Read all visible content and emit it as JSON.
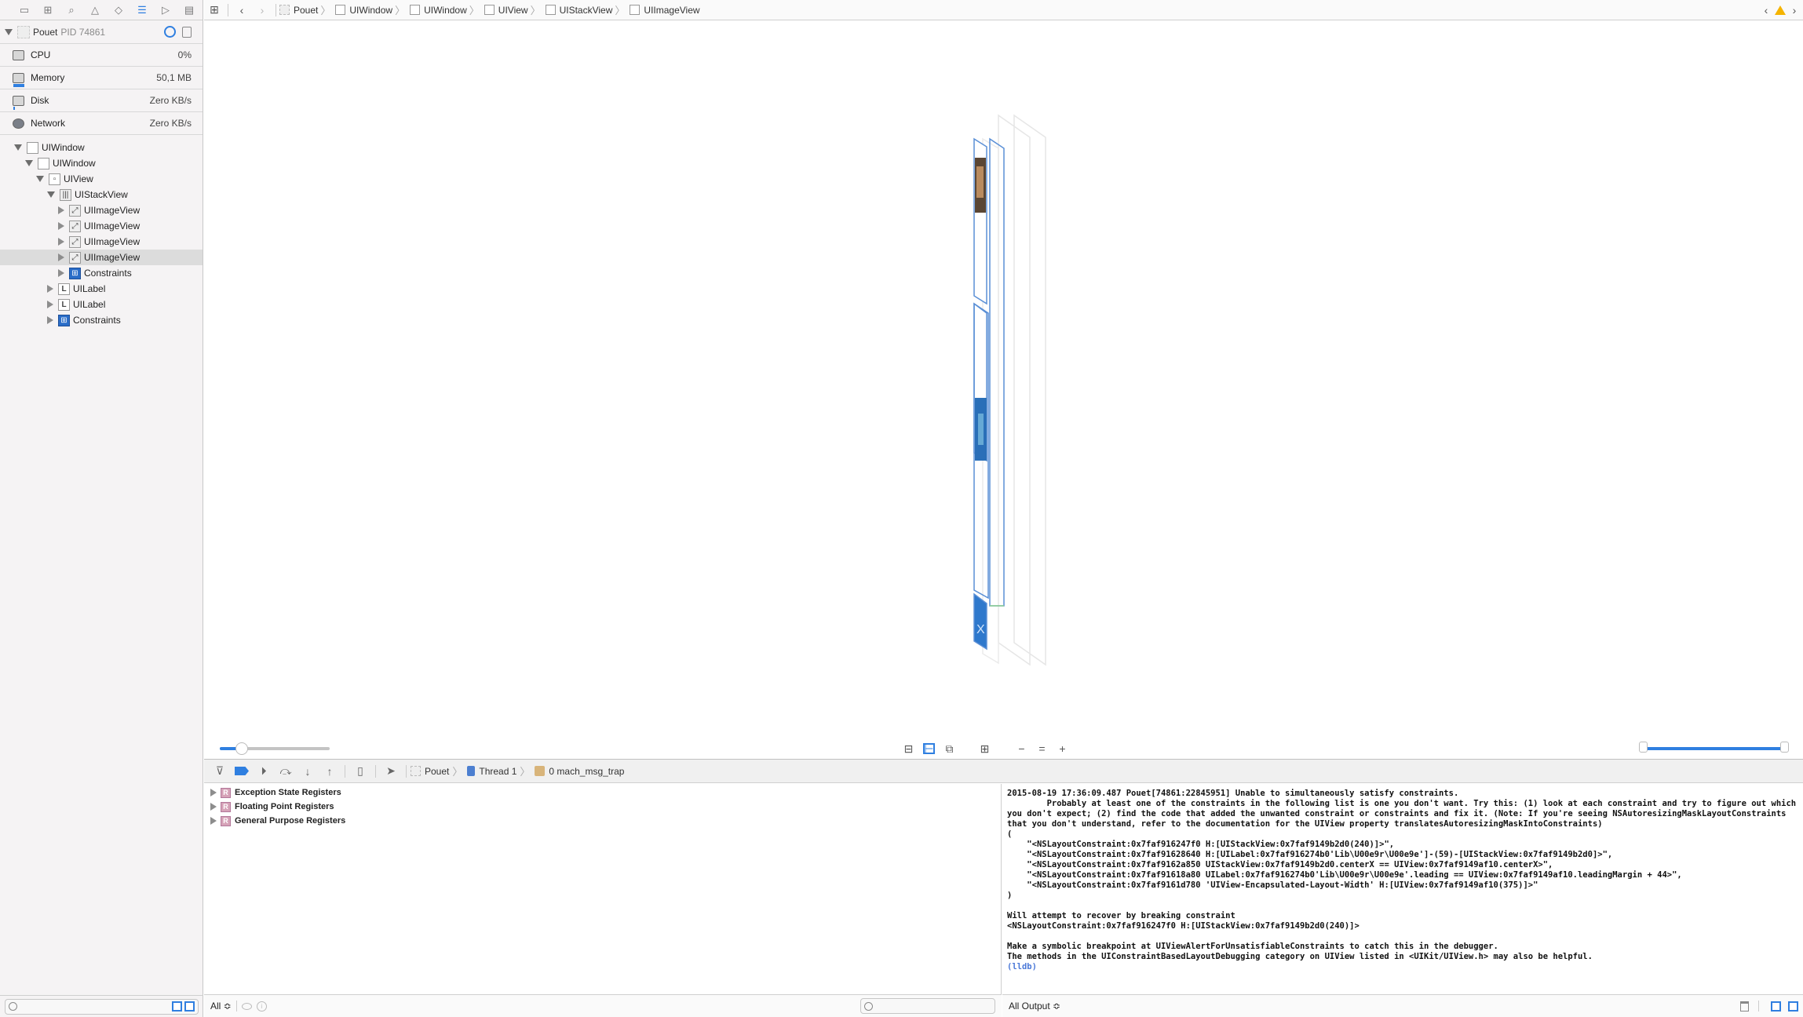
{
  "navigator": {
    "toolbar_icons": [
      "folder-icon",
      "hierarchy-icon",
      "search-icon",
      "warning-icon",
      "breakpoint-diamond-icon",
      "debug-navigator-icon",
      "tag-icon",
      "report-icon"
    ],
    "process": {
      "name": "Pouet",
      "pid": "PID 74861"
    },
    "metrics": [
      {
        "label": "CPU",
        "value": "0%",
        "icon": "cpu-icon"
      },
      {
        "label": "Memory",
        "value": "50,1 MB",
        "icon": "memory-icon",
        "gauge_fraction": 0.45
      },
      {
        "label": "Disk",
        "value": "Zero KB/s",
        "icon": "disk-icon",
        "gauge_fraction": 0.05
      },
      {
        "label": "Network",
        "value": "Zero KB/s",
        "icon": "network-icon"
      }
    ],
    "tree": [
      {
        "label": "UIWindow",
        "depth": 0,
        "expanded": true,
        "kind": "window"
      },
      {
        "label": "UIWindow",
        "depth": 1,
        "expanded": true,
        "kind": "window"
      },
      {
        "label": "UIView",
        "depth": 2,
        "expanded": true,
        "kind": "view"
      },
      {
        "label": "UIStackView",
        "depth": 3,
        "expanded": true,
        "kind": "stack"
      },
      {
        "label": "UIImageView",
        "depth": 4,
        "expanded": false,
        "kind": "image"
      },
      {
        "label": "UIImageView",
        "depth": 4,
        "expanded": false,
        "kind": "image"
      },
      {
        "label": "UIImageView",
        "depth": 4,
        "expanded": false,
        "kind": "image"
      },
      {
        "label": "UIImageView",
        "depth": 4,
        "expanded": false,
        "kind": "image",
        "selected": true
      },
      {
        "label": "Constraints",
        "depth": 4,
        "expanded": false,
        "kind": "constraints"
      },
      {
        "label": "UILabel",
        "depth": 3,
        "expanded": false,
        "kind": "label"
      },
      {
        "label": "UILabel",
        "depth": 3,
        "expanded": false,
        "kind": "label"
      },
      {
        "label": "Constraints",
        "depth": 3,
        "expanded": false,
        "kind": "constraints"
      }
    ]
  },
  "jumpbar": {
    "crumbs": [
      "Pouet",
      "UIWindow",
      "UIWindow",
      "UIView",
      "UIStackView",
      "UIImageView"
    ]
  },
  "canvas": {
    "spacing_slider_fraction": 0.2,
    "range_slider": [
      0.0,
      1.0
    ]
  },
  "debugbar": {
    "crumbs": [
      "Pouet",
      "Thread 1",
      "0 mach_msg_trap"
    ]
  },
  "variables": {
    "rows": [
      "Exception State Registers",
      "Floating Point Registers",
      "General Purpose Registers"
    ],
    "scope": "All ≎"
  },
  "console": {
    "text": "2015-08-19 17:36:09.487 Pouet[74861:22845951] Unable to simultaneously satisfy constraints.\n\tProbably at least one of the constraints in the following list is one you don't want. Try this: (1) look at each constraint and try to figure out which you don't expect; (2) find the code that added the unwanted constraint or constraints and fix it. (Note: If you're seeing NSAutoresizingMaskLayoutConstraints that you don't understand, refer to the documentation for the UIView property translatesAutoresizingMaskIntoConstraints)\n(\n    \"<NSLayoutConstraint:0x7faf916247f0 H:[UIStackView:0x7faf9149b2d0(240)]>\",\n    \"<NSLayoutConstraint:0x7faf91628640 H:[UILabel:0x7faf916274b0'Lib\\U00e9r\\U00e9e']-(59)-[UIStackView:0x7faf9149b2d0]>\",\n    \"<NSLayoutConstraint:0x7faf9162a850 UIStackView:0x7faf9149b2d0.centerX == UIView:0x7faf9149af10.centerX>\",\n    \"<NSLayoutConstraint:0x7faf91618a80 UILabel:0x7faf916274b0'Lib\\U00e9r\\U00e9e'.leading == UIView:0x7faf9149af10.leadingMargin + 44>\",\n    \"<NSLayoutConstraint:0x7faf9161d780 'UIView-Encapsulated-Layout-Width' H:[UIView:0x7faf9149af10(375)]>\"\n)\n\nWill attempt to recover by breaking constraint \n<NSLayoutConstraint:0x7faf916247f0 H:[UIStackView:0x7faf9149b2d0(240)]>\n\nMake a symbolic breakpoint at UIViewAlertForUnsatisfiableConstraints to catch this in the debugger.\nThe methods in the UIConstraintBasedLayoutDebugging category on UIView listed in <UIKit/UIView.h> may also be helpful.",
    "prompt": "(lldb)",
    "output_filter": "All Output ≎"
  },
  "colors": {
    "accent": "#2f7fe0",
    "warning": "#f5b400",
    "prompt": "#4a78d8"
  }
}
